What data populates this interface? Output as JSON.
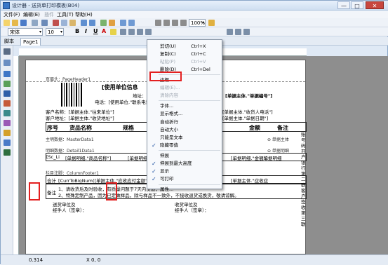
{
  "window": {
    "title": "设计器 - 送货单打印模板(B04)",
    "min": "—",
    "max": "□",
    "close": "✕"
  },
  "menubar": {
    "items": [
      {
        "label": "文件(F)",
        "disabled": false
      },
      {
        "label": "编辑(E)",
        "disabled": false
      },
      {
        "label": "插件",
        "disabled": true
      },
      {
        "label": "工具(T)",
        "disabled": false
      },
      {
        "label": "帮助(H)",
        "disabled": false
      }
    ]
  },
  "toolbar": {
    "font_name": "宋体",
    "font_size": "10",
    "bold": "B",
    "italic": "I",
    "underline": "U",
    "font_color": "A",
    "zoom": "100%"
  },
  "tabs": [
    {
      "label": "脚本"
    },
    {
      "label": "Page1"
    }
  ],
  "report": {
    "page_header_label": "页眉头：PageHeader1",
    "title": "[使用单位信息",
    "title_right": "[单据主体.\"单据编号\"]",
    "address_label": "地址：[",
    "phone_label": "电话：[使用单位.\"联系电话\"]",
    "customer_name": "客户名称：[单据主体.\"往来单位\"]",
    "customer_addr": "客户地址：[单据主体.\"收货地址\"]",
    "receiver": "[单据主体.\"收货人电话\"]",
    "date": "[单据主体.\"单据日期\"]",
    "col_no": "序号",
    "col_name": "货品名称",
    "col_spec": "规格",
    "col_amount": "金额",
    "col_remark": "备注",
    "master_label": "主明数据：MasterData1",
    "detail_label": "明细数据：Detail1Data1",
    "detail_no": "[Sc_Li",
    "detail_name": "[单据明细.\"商品名称\"]",
    "detail_spec": "[单据明细.\"规格",
    "detail_amt": "[单据明细.\"金额\"]",
    "detail_remark": "[单据明细",
    "detail_flag": "⊖ 单据明细",
    "master_flag": "⊖ 单据主体",
    "footer_label": "栏目注脚：ColumnFooter1",
    "total_label": "合计",
    "total_big": "[CurrToBigNum([单据主体.\"应收应付金额\"",
    "total_amt": "[单据主体.\"应收应",
    "remark_label": "备注",
    "remark_1": "1、请收货后及时验收，有质量问题于7天内反馈，",
    "remark_2": "2、特殊定制产品，因为已定做样品，除与样品不一致外，不接收退货或换货，敬请谅解。",
    "sign_left_1": "送货单位及",
    "sign_left_2": "经手人（签章）：",
    "sign_right_1": "收货单位及",
    "sign_right_2": "经手人（签章）：",
    "side_labels": [
      "账",
      "号",
      "码",
      "开",
      "户",
      "银",
      "行",
      "第",
      "二",
      "联",
      "客",
      "户",
      "签",
      "收",
      "第",
      "三",
      "联"
    ]
  },
  "context_menu": {
    "items": [
      {
        "label": "剪切(U)",
        "shortcut": "Ctrl+X",
        "disabled": false,
        "checked": false
      },
      {
        "label": "复制(C)",
        "shortcut": "Ctrl+C",
        "disabled": false,
        "checked": false
      },
      {
        "label": "粘贴(P)",
        "shortcut": "Ctrl+V",
        "disabled": true,
        "checked": false
      },
      {
        "label": "删除(D)",
        "shortcut": "Ctrl+Del",
        "disabled": false,
        "checked": false
      },
      {
        "label": "边框...",
        "shortcut": "",
        "disabled": false,
        "checked": false
      },
      {
        "label": "编辑(E)...",
        "shortcut": "",
        "disabled": true,
        "checked": false
      },
      {
        "label": "清除内容",
        "shortcut": "",
        "disabled": true,
        "checked": false
      },
      {
        "label": "字体...",
        "shortcut": "",
        "disabled": false,
        "checked": false
      },
      {
        "label": "显示格式...",
        "shortcut": "",
        "disabled": false,
        "checked": false
      },
      {
        "label": "自动折行",
        "shortcut": "",
        "disabled": false,
        "checked": false
      },
      {
        "label": "自动大小",
        "shortcut": "",
        "disabled": false,
        "checked": false
      },
      {
        "label": "只能是文本",
        "shortcut": "",
        "disabled": false,
        "checked": false
      },
      {
        "label": "隐藏零值",
        "shortcut": "",
        "disabled": false,
        "checked": true
      },
      {
        "label": "伸展",
        "shortcut": "",
        "disabled": false,
        "checked": false
      },
      {
        "label": "伸展到最大高度",
        "shortcut": "",
        "disabled": false,
        "checked": true
      },
      {
        "label": "显示",
        "shortcut": "",
        "disabled": false,
        "checked": true
      },
      {
        "label": "可打印",
        "shortcut": "",
        "disabled": false,
        "checked": true
      },
      {
        "label": "属性...",
        "shortcut": "",
        "disabled": false,
        "checked": false
      }
    ]
  },
  "statusbar": {
    "pos": "0.314",
    "xy": "X 0, 0"
  },
  "colors": {
    "accent_red": "#e32020",
    "title_bar": "#cfdff1",
    "canvas": "#8e8e8e"
  }
}
